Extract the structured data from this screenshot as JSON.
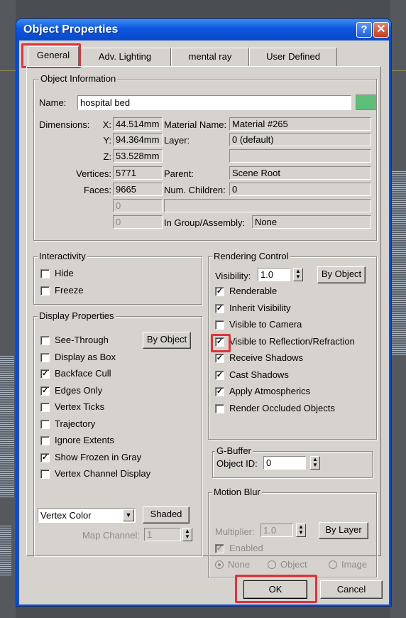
{
  "window": {
    "title": "Object Properties",
    "help": "?",
    "close": "✕"
  },
  "tabs": [
    "General",
    "Adv. Lighting",
    "mental ray",
    "User Defined"
  ],
  "object_info": {
    "legend": "Object Information",
    "name_label": "Name:",
    "name_value": "hospital bed",
    "color": "#5dbf7a",
    "dimensions_label": "Dimensions:",
    "x_label": "X:",
    "x": "44.514mm",
    "y_label": "Y:",
    "y": "94.364mm",
    "z_label": "Z:",
    "z": "53.528mm",
    "vertices_label": "Vertices:",
    "vertices": "5771",
    "faces_label": "Faces:",
    "faces": "9665",
    "blank1": "0",
    "blank2": "0",
    "material_label": "Material Name:",
    "material": "Material #265",
    "layer_label": "Layer:",
    "layer": "0 (default)",
    "parent_label": "Parent:",
    "parent": "Scene Root",
    "children_label": "Num. Children:",
    "children": "0",
    "group_label": "In Group/Assembly:",
    "group": "None"
  },
  "interactivity": {
    "legend": "Interactivity",
    "hide": "Hide",
    "freeze": "Freeze"
  },
  "display": {
    "legend": "Display Properties",
    "by_object": "By Object",
    "items": [
      {
        "label": "See-Through",
        "checked": false
      },
      {
        "label": "Display as Box",
        "checked": false
      },
      {
        "label": "Backface Cull",
        "checked": true
      },
      {
        "label": "Edges Only",
        "checked": true
      },
      {
        "label": "Vertex Ticks",
        "checked": false
      },
      {
        "label": "Trajectory",
        "checked": false
      },
      {
        "label": "Ignore Extents",
        "checked": false
      },
      {
        "label": "Show Frozen in Gray",
        "checked": true
      },
      {
        "label": "Vertex Channel Display",
        "checked": false
      }
    ],
    "vertex_select": "Vertex Color",
    "shaded": "Shaded",
    "map_channel_label": "Map Channel:",
    "map_channel": "1"
  },
  "rendering": {
    "legend": "Rendering Control",
    "visibility_label": "Visibility:",
    "visibility": "1.0",
    "by_object": "By Object",
    "items": [
      {
        "label": "Renderable",
        "checked": true
      },
      {
        "label": "Inherit Visibility",
        "checked": true
      },
      {
        "label": "Visible to Camera",
        "checked": false
      },
      {
        "label": "Visible to Reflection/Refraction",
        "checked": true
      },
      {
        "label": "Receive Shadows",
        "checked": true
      },
      {
        "label": "Cast Shadows",
        "checked": true
      },
      {
        "label": "Apply Atmospherics",
        "checked": true
      },
      {
        "label": "Render Occluded Objects",
        "checked": false
      }
    ]
  },
  "gbuffer": {
    "legend": "G-Buffer",
    "object_id_label": "Object ID:",
    "object_id": "0"
  },
  "motion_blur": {
    "legend": "Motion Blur",
    "multiplier_label": "Multiplier:",
    "multiplier": "1.0",
    "by_layer": "By Layer",
    "enabled": "Enabled",
    "none": "None",
    "object": "Object",
    "image": "Image"
  },
  "buttons": {
    "ok": "OK",
    "cancel": "Cancel"
  },
  "highlight_color": "#e0333a"
}
